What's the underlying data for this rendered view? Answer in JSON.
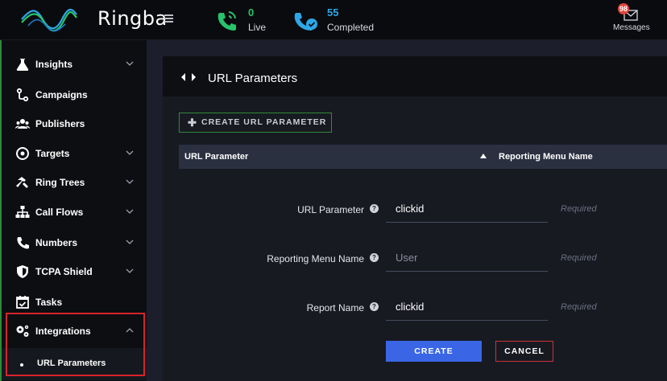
{
  "app": {
    "name": "Ringba"
  },
  "topbar": {
    "live": {
      "count": "0",
      "label": "Live"
    },
    "completed": {
      "count": "55",
      "label": "Completed"
    },
    "messages": {
      "badge": "98",
      "label": "Messages"
    }
  },
  "sidebar": {
    "items": [
      {
        "label": "Insights",
        "icon": "flask-icon",
        "has_chevron": true
      },
      {
        "label": "Campaigns",
        "icon": "campaign-icon",
        "has_chevron": false
      },
      {
        "label": "Publishers",
        "icon": "publishers-icon",
        "has_chevron": false
      },
      {
        "label": "Targets",
        "icon": "target-icon",
        "has_chevron": true
      },
      {
        "label": "Ring Trees",
        "icon": "hammer-icon",
        "has_chevron": true
      },
      {
        "label": "Call Flows",
        "icon": "sitemap-icon",
        "has_chevron": true
      },
      {
        "label": "Numbers",
        "icon": "phone-icon",
        "has_chevron": true
      },
      {
        "label": "TCPA Shield",
        "icon": "shield-icon",
        "has_chevron": true
      },
      {
        "label": "Tasks",
        "icon": "calendar-check-icon",
        "has_chevron": false
      },
      {
        "label": "Integrations",
        "icon": "cogs-icon",
        "has_chevron": true,
        "expanded": true
      }
    ],
    "sub_items": [
      {
        "label": "URL Parameters"
      }
    ]
  },
  "page": {
    "title": "URL Parameters",
    "create_button": "CREATE URL PARAMETER",
    "table": {
      "columns": [
        "URL Parameter",
        "Reporting Menu Name"
      ],
      "sort_indicator": "▲"
    },
    "form": {
      "fields": [
        {
          "label": "URL Parameter",
          "value": "clickid",
          "placeholder": "",
          "required_hint": "Required"
        },
        {
          "label": "Reporting Menu Name",
          "value": "",
          "placeholder": "User",
          "required_hint": "Required"
        },
        {
          "label": "Report Name",
          "value": "clickid",
          "placeholder": "",
          "required_hint": "Required"
        }
      ],
      "create_label": "CREATE",
      "cancel_label": "CANCEL"
    }
  },
  "colors": {
    "accent_green": "#27c46b",
    "accent_blue": "#2ea7e8",
    "primary_button": "#3a66e6",
    "danger": "#c8333a",
    "highlight": "#d8232a"
  }
}
